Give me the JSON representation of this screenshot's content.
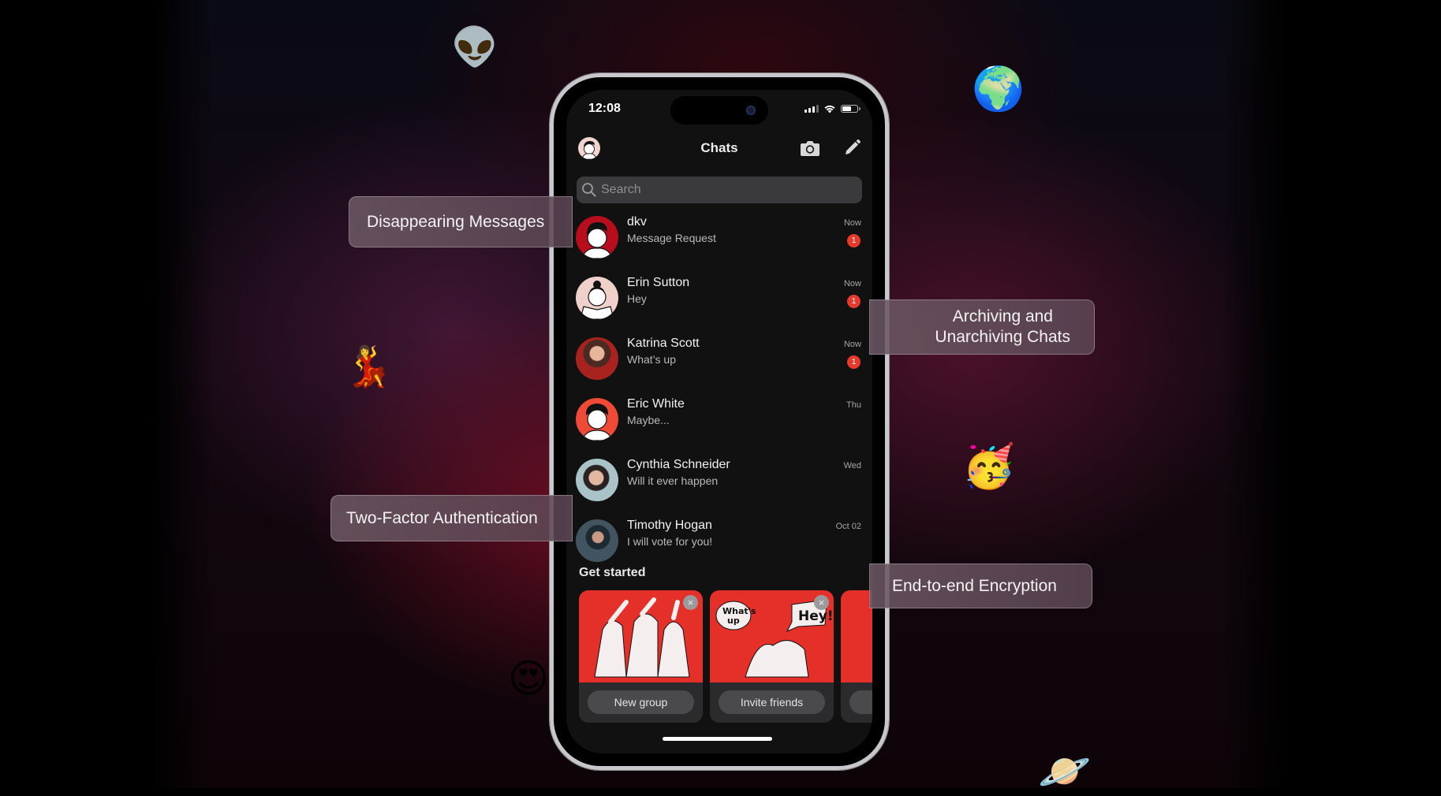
{
  "status_bar": {
    "time": "12:08"
  },
  "header": {
    "title": "Chats"
  },
  "search": {
    "placeholder": "Search"
  },
  "chats": [
    {
      "name": "dkv",
      "message": "Message Request",
      "time": "Now",
      "unread": "1",
      "avatar_color": "#b80d1c"
    },
    {
      "name": "Erin Sutton",
      "message": "Hey",
      "time": "Now",
      "unread": "1",
      "avatar_color": "#f0d0cb"
    },
    {
      "name": "Katrina Scott",
      "message": "What’s up",
      "time": "Now",
      "unread": "1",
      "avatar_color": "#8a5648"
    },
    {
      "name": "Eric White",
      "message": "Maybe...",
      "time": "Thu",
      "unread": null,
      "avatar_color": "#ee4a36"
    },
    {
      "name": "Cynthia Schneider",
      "message": "Will it ever happen",
      "time": "Wed",
      "unread": null,
      "avatar_color": "#9fb4b8"
    },
    {
      "name": "Timothy Hogan",
      "message": "I will vote for you!",
      "time": "Oct 02",
      "unread": null,
      "avatar_color": "#3e4f5e"
    }
  ],
  "get_started": {
    "title": "Get started",
    "cards": [
      {
        "label": "New group",
        "art_text": ""
      },
      {
        "label": "Invite friends",
        "art_text_left": "What's up",
        "art_text_right": "Hey!"
      },
      {
        "label": ""
      }
    ]
  },
  "callouts": {
    "disappearing": "Disappearing Messages",
    "archiving_line1": "Archiving and",
    "archiving_line2": "Unarchiving Chats",
    "two_factor": "Two-Factor Authentication",
    "e2e": "End-to-end Encryption"
  },
  "emojis": {
    "alien": "👽",
    "globe": "🌍",
    "dancer": "💃",
    "party": "🥳",
    "heart_eyes": "😍",
    "planet": "🪐"
  },
  "colors": {
    "accent_red": "#e5302a",
    "badge_red": "#e53a2c"
  }
}
